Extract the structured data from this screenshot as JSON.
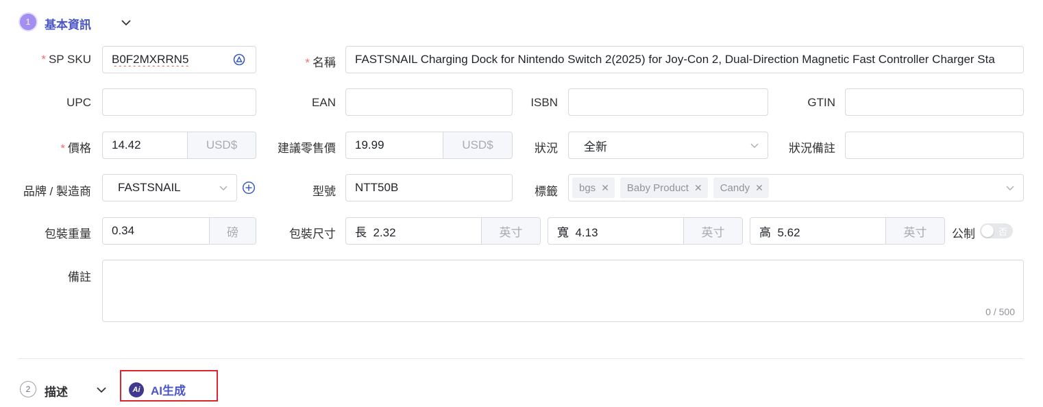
{
  "sections": {
    "basic": {
      "number": "1",
      "title": "基本資訊"
    },
    "description": {
      "number": "2",
      "title": "描述",
      "ai_button": "AI生成",
      "ai_icon_text": "Ai"
    }
  },
  "fields": {
    "sp_sku": {
      "label": "SP SKU",
      "value": "B0F2MXRRN5"
    },
    "name": {
      "label": "名稱",
      "value": "FASTSNAIL Charging Dock for Nintendo Switch 2(2025) for Joy-Con 2, Dual-Direction Magnetic Fast Controller Charger Sta"
    },
    "upc": {
      "label": "UPC",
      "value": ""
    },
    "ean": {
      "label": "EAN",
      "value": ""
    },
    "isbn": {
      "label": "ISBN",
      "value": ""
    },
    "gtin": {
      "label": "GTIN",
      "value": ""
    },
    "price": {
      "label": "價格",
      "value": "14.42",
      "currency": "USD$"
    },
    "msrp": {
      "label": "建議零售價",
      "value": "19.99",
      "currency": "USD$"
    },
    "condition": {
      "label": "狀況",
      "value": "全新"
    },
    "condition_note": {
      "label": "狀況備註",
      "value": ""
    },
    "brand": {
      "label": "品牌 / 製造商",
      "value": "FASTSNAIL"
    },
    "model": {
      "label": "型號",
      "value": "NTT50B"
    },
    "tags": {
      "label": "標籤",
      "items": [
        "bgs",
        "Baby Product",
        "Candy"
      ]
    },
    "weight": {
      "label": "包裝重量",
      "value": "0.34",
      "unit": "磅"
    },
    "dimensions": {
      "label": "包裝尺寸",
      "length": {
        "prefix": "長",
        "value": "2.32",
        "unit": "英寸"
      },
      "width": {
        "prefix": "寬",
        "value": "4.13",
        "unit": "英寸"
      },
      "height": {
        "prefix": "高",
        "value": "5.62",
        "unit": "英寸"
      },
      "metric_label": "公制",
      "metric_toggle": "否"
    },
    "notes": {
      "label": "備註",
      "value": "",
      "counter": "0 / 500"
    }
  },
  "colors": {
    "accent": "#5b5fd6",
    "required": "#f56c6c",
    "highlight_box": "#d9262c"
  }
}
